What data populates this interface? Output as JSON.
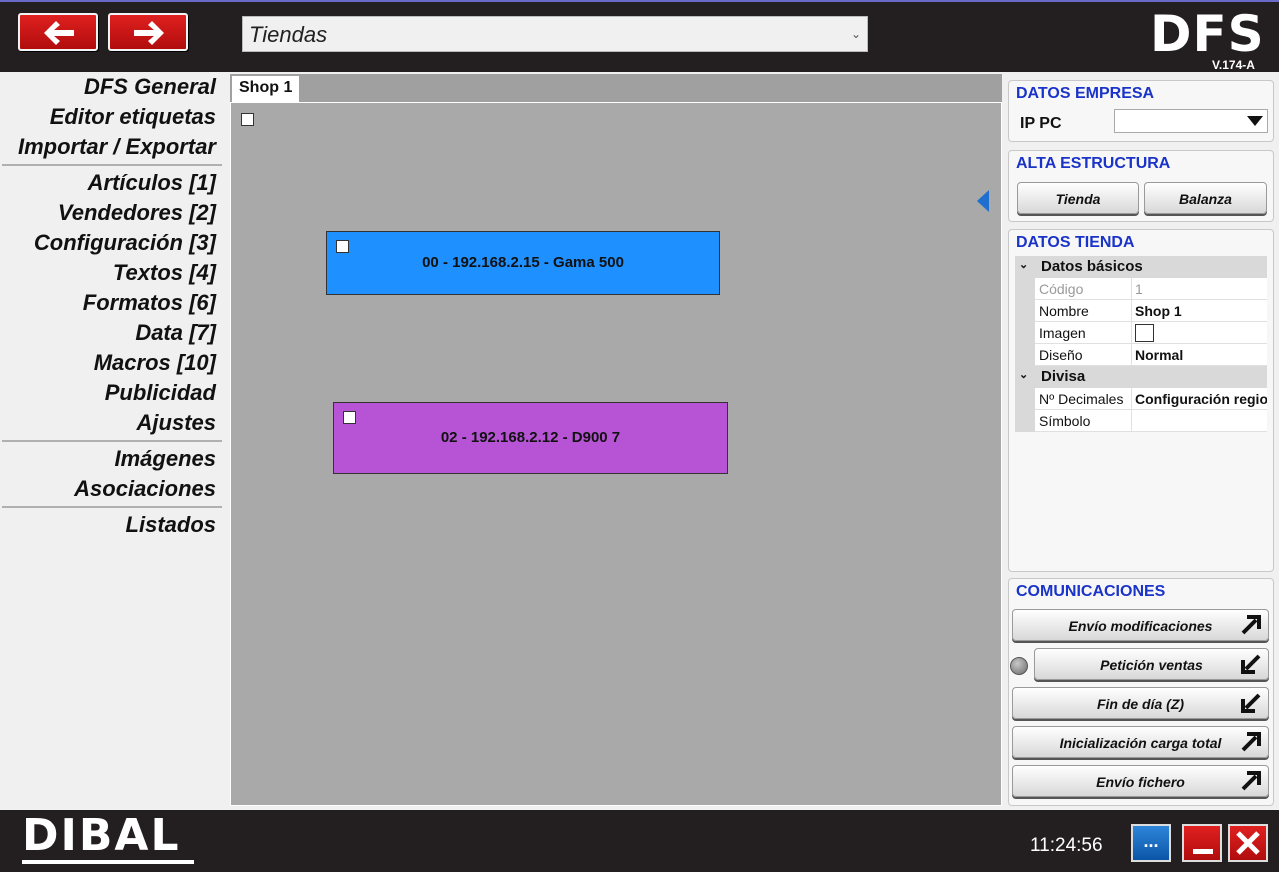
{
  "header": {
    "section_select_value": "Tiendas",
    "logo": "DFS",
    "version": "V.174-A",
    "back_icon": "arrow-left-icon",
    "forward_icon": "arrow-right-icon"
  },
  "nav": {
    "items": [
      "DFS General",
      "Editor etiquetas",
      "Importar / Exportar",
      "Artículos [1]",
      "Vendedores [2]",
      "Configuración [3]",
      "Textos [4]",
      "Formatos [6]",
      "Data [7]",
      "Macros [10]",
      "Publicidad",
      "Ajustes",
      "Imágenes",
      "Asociaciones",
      "Listados"
    ]
  },
  "canvas": {
    "tab_label": "Shop 1",
    "devices": [
      {
        "label": "00 - 192.168.2.15 - Gama 500",
        "color": "#1f90ff"
      },
      {
        "label": "02 - 192.168.2.12 - D900 7",
        "color": "#b754d5"
      }
    ]
  },
  "panel": {
    "datos_empresa": {
      "title": "DATOS EMPRESA",
      "ip_label": "IP PC",
      "ip_value": ""
    },
    "alta_estructura": {
      "title": "ALTA ESTRUCTURA",
      "buttons": [
        "Tienda",
        "Balanza"
      ]
    },
    "datos_tienda": {
      "title": "DATOS TIENDA",
      "cat1": "Datos básicos",
      "codigo_label": "Código",
      "codigo_value": "1",
      "nombre_label": "Nombre",
      "nombre_value": "Shop 1",
      "imagen_label": "Imagen",
      "diseno_label": "Diseño",
      "diseno_value": "Normal",
      "cat2": "Divisa",
      "decimales_label": "Nº Decimales",
      "decimales_value": "Configuración regional",
      "simbolo_label": "Símbolo",
      "simbolo_value": ""
    },
    "comunicaciones": {
      "title": "COMUNICACIONES",
      "buttons": [
        {
          "label": "Envío modificaciones",
          "icon": "arrow-up-right-icon"
        },
        {
          "label": "Petición ventas",
          "icon": "arrow-down-left-icon"
        },
        {
          "label": "Fin de día (Z)",
          "icon": "arrow-down-left-icon"
        },
        {
          "label": "Inicialización carga total",
          "icon": "arrow-up-right-icon"
        },
        {
          "label": "Envío fichero",
          "icon": "arrow-up-right-icon"
        }
      ]
    }
  },
  "footer": {
    "brand": "DIBAL",
    "clock": "11:24:56",
    "more_label": "...",
    "colors": {
      "bar": "#231f20",
      "red_button": "#c81414",
      "blue_button": "#1a6ec0"
    }
  }
}
